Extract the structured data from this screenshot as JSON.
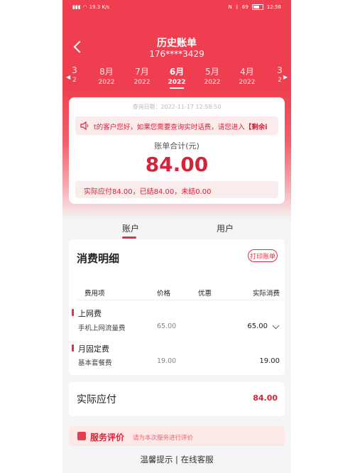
{
  "status_bar": {
    "network_speed": "19.3 K/s",
    "battery_percent": "69",
    "time": "12:58"
  },
  "header": {
    "title": "历史账单",
    "phone_number": "176****3429"
  },
  "months": [
    {
      "label": "3",
      "year": "2"
    },
    {
      "label": "8月",
      "year": "2022"
    },
    {
      "label": "7月",
      "year": "2022"
    },
    {
      "label": "6月",
      "year": "2022",
      "active": true
    },
    {
      "label": "5月",
      "year": "2022"
    },
    {
      "label": "4月",
      "year": "2022"
    },
    {
      "label": "3",
      "year": "2"
    }
  ],
  "summary": {
    "query_date": "查询日期：2022-11-17 12:58:50",
    "notice_text": "t的客户您好，如果您需要查询实时话费，请您进入",
    "notice_highlight": "【剩余i",
    "total_label": "账单合计(元)",
    "total_amount": "84.00",
    "paid_info": "实际应付84.00，已结84.00，未结0.00"
  },
  "tabs": {
    "account": "账户",
    "user": "用户"
  },
  "detail": {
    "title": "消费明细",
    "print_button": "打印账单",
    "headers": {
      "item": "费用项",
      "price": "价格",
      "discount": "优惠",
      "actual": "实际消费"
    },
    "groups": [
      {
        "name": "上网费",
        "items": [
          {
            "name": "手机上网流量费",
            "price": "65.00",
            "actual": "65.00"
          }
        ]
      },
      {
        "name": "月固定费",
        "items": [
          {
            "name": "基本套餐费",
            "price": "19.00",
            "actual": "19.00"
          }
        ]
      }
    ]
  },
  "total": {
    "label": "实际应付",
    "value": "84.00"
  },
  "service": {
    "title": "服务评价",
    "subtitle": "请为本次服务进行评价"
  },
  "footer": {
    "text": "温馨提示 | 在线客服"
  },
  "colors": {
    "brand_red": "#ef3e4f",
    "accent": "#e23145",
    "text_red": "#d6233a"
  },
  "icons": [
    "back-chevron-icon",
    "speaker-icon",
    "chevron-down-icon",
    "service-icon",
    "battery-icon",
    "signal-icon"
  ]
}
